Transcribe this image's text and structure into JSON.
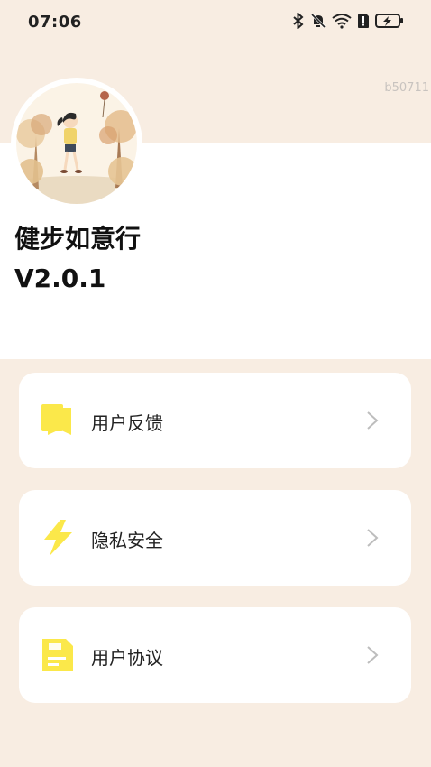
{
  "status_bar": {
    "time": "07:06",
    "icons": [
      "bluetooth-icon",
      "mute-icon",
      "wifi-icon",
      "sim-alert-icon",
      "battery-charging-icon"
    ]
  },
  "version_code": "b50711",
  "app": {
    "name": "健步如意行",
    "version": "V2.0.1"
  },
  "menu": [
    {
      "label": "用户反馈",
      "icon": "feedback-icon"
    },
    {
      "label": "隐私安全",
      "icon": "lightning-icon"
    },
    {
      "label": "用户协议",
      "icon": "document-icon"
    }
  ],
  "colors": {
    "background": "#F8EDE2",
    "card": "#FFFFFF",
    "accent_yellow": "#FBE84A",
    "chevron": "#BDBDBD"
  }
}
